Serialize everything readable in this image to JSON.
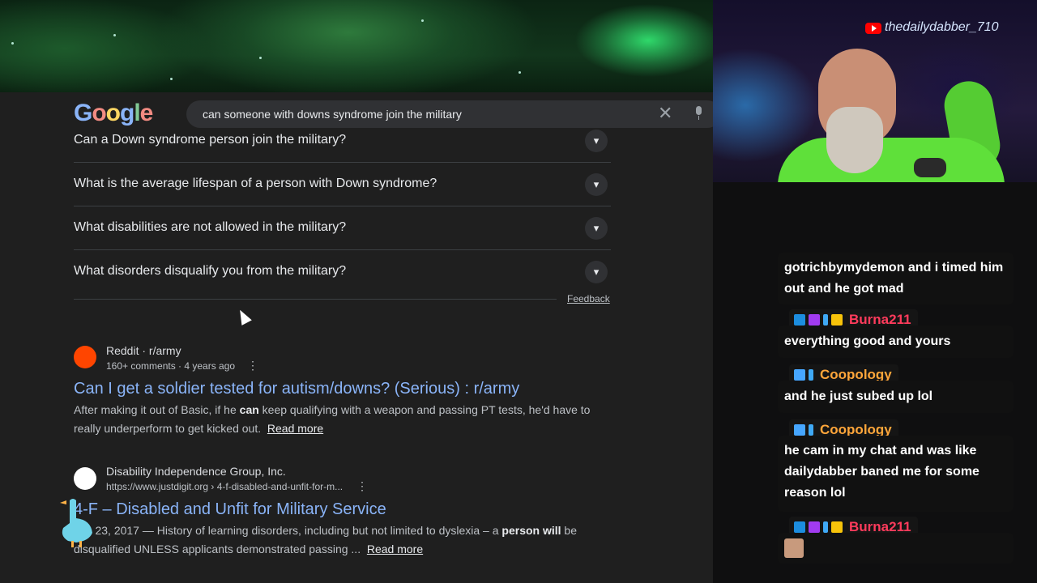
{
  "google": {
    "logo_letters": [
      "G",
      "o",
      "o",
      "g",
      "l",
      "e"
    ],
    "search_query": "can someone with downs syndrome join the military",
    "clear_icon": "close-icon",
    "mic_icon": "microphone-icon"
  },
  "people_also_ask": [
    {
      "question": "Can a Down syndrome person join the military?",
      "icon": "chevron-down-icon"
    },
    {
      "question": "What is the average lifespan of a person with Down syndrome?",
      "icon": "chevron-down-icon"
    },
    {
      "question": "What disabilities are not allowed in the military?",
      "icon": "chevron-down-icon"
    },
    {
      "question": "What disorders disqualify you from the military?",
      "icon": "chevron-down-icon"
    }
  ],
  "feedback_label": "Feedback",
  "results": [
    {
      "site": "Reddit · r/army",
      "meta": "160+ comments · 4 years ago",
      "title": "Can I get a soldier tested for autism/downs? (Serious) : r/army",
      "snippet_a": "After making it out of Basic, if he ",
      "snippet_bold": "can",
      "snippet_b": " keep qualifying with a weapon and passing PT tests, he'd have to really underperform to get kicked out.",
      "read_more": "Read more"
    },
    {
      "site": "Disability Independence Group, Inc.",
      "meta": "https://www.justdigit.org › 4-f-disabled-and-unfit-for-m...",
      "title": "4-F – Disabled and Unfit for Military Service",
      "snippet_a": "Jun 23, 2017 — History of learning disorders, including but not limited to dyslexia – a ",
      "snippet_bold": "person will",
      "snippet_b": " be disqualified UNLESS applicants demonstrated passing ...",
      "read_more": "Read more"
    }
  ],
  "webcam": {
    "channel": "thedailydabber_710"
  },
  "chat": [
    {
      "text": "gotrichbymydemon and i timed him out and he got mad"
    },
    {
      "user": "Burna211",
      "color": "#ff3b5c",
      "badges": [
        "prime",
        "cube",
        "hype",
        "crown"
      ]
    },
    {
      "text": "everything good and yours"
    },
    {
      "user": "Coopology",
      "color": "#ffa63a",
      "badges": [
        "vip",
        "hype"
      ]
    },
    {
      "text": "and he just subed up lol"
    },
    {
      "user": "Coopology",
      "color": "#ffa63a",
      "badges": [
        "vip",
        "hype"
      ]
    },
    {
      "text": "he cam in my chat and was like dailydabber baned me for some reason lol"
    },
    {
      "user": "Burna211",
      "color": "#ff3b5c",
      "badges": [
        "prime",
        "cube",
        "hype",
        "crown"
      ]
    }
  ]
}
